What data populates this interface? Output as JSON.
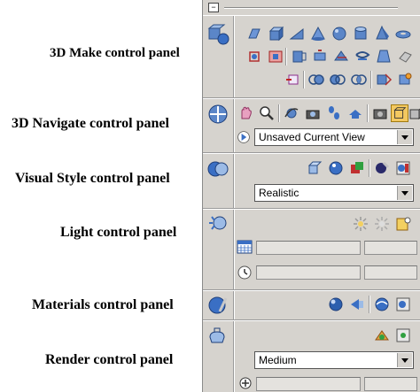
{
  "labels": {
    "make": "3D Make control panel",
    "navigate": "3D Navigate control panel",
    "visual": "Visual Style control panel",
    "light": "Light control panel",
    "materials": "Materials control panel",
    "render": "Render control panel"
  },
  "navigate": {
    "view_select": "Unsaved Current View"
  },
  "visual": {
    "style_select": "Realistic"
  },
  "render": {
    "preset_select": "Medium"
  },
  "colors": {
    "palette_bg": "#d6d3ce",
    "accent_blue": "#3a6fc4"
  }
}
